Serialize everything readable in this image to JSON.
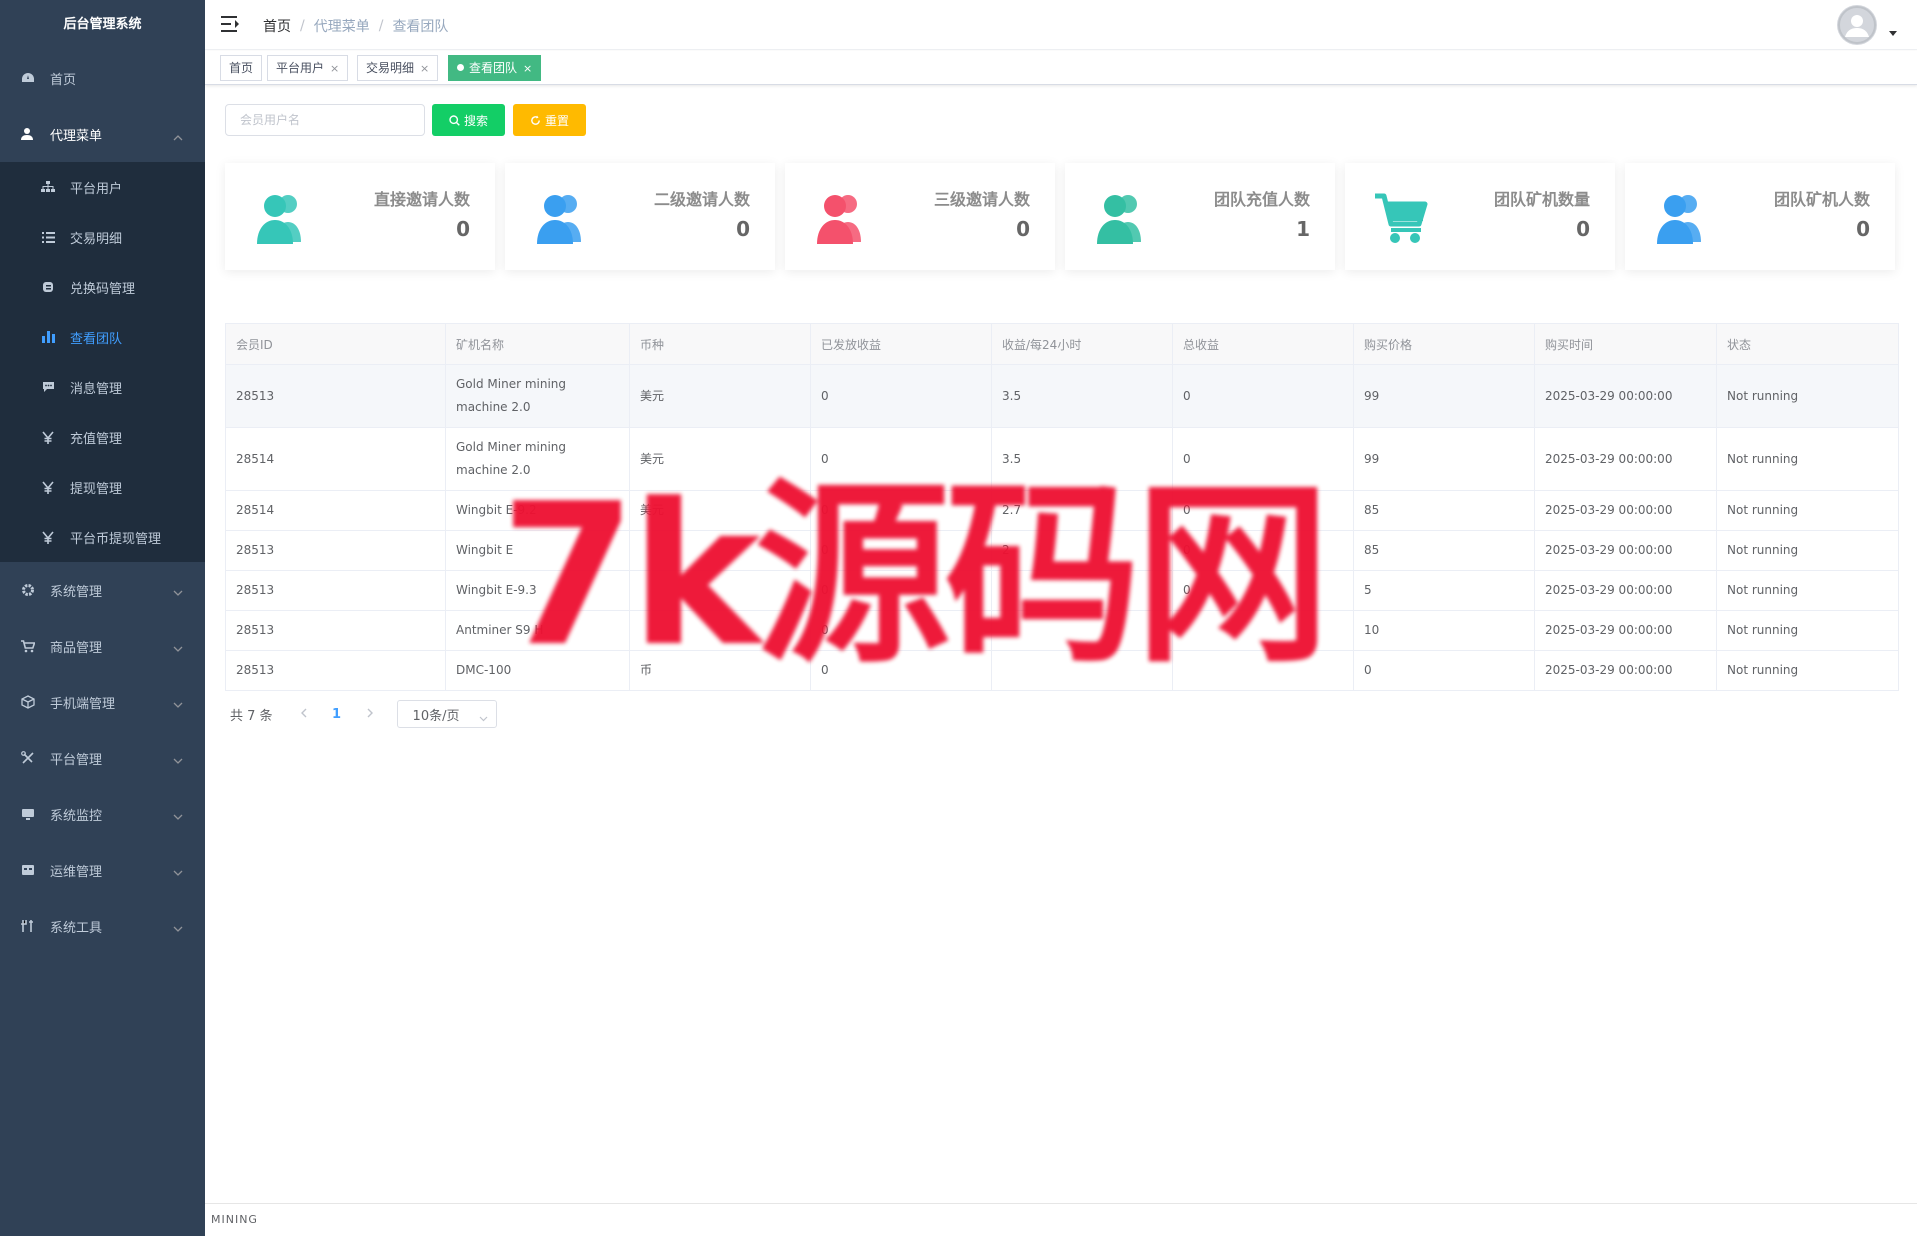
{
  "app": {
    "title": "后台管理系统"
  },
  "sidebar": {
    "items": [
      {
        "label": "首页",
        "icon": "dashboard-icon"
      },
      {
        "label": "代理菜单",
        "icon": "user-icon",
        "expanded": true,
        "children": [
          {
            "label": "平台用户",
            "icon": "org-tree-icon"
          },
          {
            "label": "交易明细",
            "icon": "list-icon"
          },
          {
            "label": "兑换码管理",
            "icon": "code-icon"
          },
          {
            "label": "查看团队",
            "icon": "bar-chart-icon",
            "active": true
          },
          {
            "label": "消息管理",
            "icon": "message-icon"
          },
          {
            "label": "充值管理",
            "icon": "yen-icon"
          },
          {
            "label": "提现管理",
            "icon": "yen-icon"
          },
          {
            "label": "平台币提现管理",
            "icon": "yen-icon"
          }
        ]
      },
      {
        "label": "系统管理",
        "icon": "gear-icon"
      },
      {
        "label": "商品管理",
        "icon": "shopping-cart-icon"
      },
      {
        "label": "手机端管理",
        "icon": "box-icon"
      },
      {
        "label": "平台管理",
        "icon": "tools-icon"
      },
      {
        "label": "系统监控",
        "icon": "monitor-icon"
      },
      {
        "label": "运维管理",
        "icon": "server-icon"
      },
      {
        "label": "系统工具",
        "icon": "wrench-icon"
      }
    ]
  },
  "breadcrumb": {
    "home": "首页",
    "parent": "代理菜单",
    "current": "查看团队",
    "separator": "/"
  },
  "tags": [
    {
      "label": "首页",
      "closable": false,
      "active": false
    },
    {
      "label": "平台用户",
      "closable": true,
      "active": false
    },
    {
      "label": "交易明细",
      "closable": true,
      "active": false
    },
    {
      "label": "查看团队",
      "closable": true,
      "active": true
    }
  ],
  "tag_close_glyph": "×",
  "search": {
    "placeholder": "会员用户名",
    "search_label": "搜索",
    "reset_label": "重置"
  },
  "cards": [
    {
      "title": "直接邀请人数",
      "value": "0",
      "icon": "people-icon",
      "color": "#36c6b8"
    },
    {
      "title": "二级邀请人数",
      "value": "0",
      "icon": "people-icon",
      "color": "#3a9ff0"
    },
    {
      "title": "三级邀请人数",
      "value": "0",
      "icon": "people-icon",
      "color": "#f4516c"
    },
    {
      "title": "团队充值人数",
      "value": "1",
      "icon": "people-icon",
      "color": "#34bfa3"
    },
    {
      "title": "团队矿机数量",
      "value": "0",
      "icon": "shopping-cart-icon",
      "color": "#36c6b8"
    },
    {
      "title": "团队矿机人数",
      "value": "0",
      "icon": "people-icon",
      "color": "#3a9ff0"
    }
  ],
  "table": {
    "columns": [
      "会员ID",
      "矿机名称",
      "币种",
      "已发放收益",
      "收益/每24小时",
      "总收益",
      "购买价格",
      "购买时间",
      "状态"
    ],
    "rows": [
      [
        "28513",
        "Gold Miner mining machine 2.0",
        "美元",
        "0",
        "3.5",
        "0",
        "99",
        "2025-03-29 00:00:00",
        "Not running"
      ],
      [
        "28514",
        "Gold Miner mining machine 2.0",
        "美元",
        "0",
        "3.5",
        "0",
        "99",
        "2025-03-29 00:00:00",
        "Not running"
      ],
      [
        "28514",
        "Wingbit E-9.2",
        "美元",
        "0",
        "2.7",
        "0",
        "85",
        "2025-03-29 00:00:00",
        "Not running"
      ],
      [
        "28513",
        "Wingbit E",
        "",
        "0",
        "2",
        "0",
        "85",
        "2025-03-29 00:00:00",
        "Not running"
      ],
      [
        "28513",
        "Wingbit E-9.3",
        "",
        "0",
        "",
        "0",
        "5",
        "2025-03-29 00:00:00",
        "Not running"
      ],
      [
        "28513",
        "Antminer S9 H",
        "",
        "0",
        "",
        "",
        "10",
        "2025-03-29 00:00:00",
        "Not running"
      ],
      [
        "28513",
        "DMC-100",
        "币",
        "0",
        "",
        "",
        "0",
        "2025-03-29 00:00:00",
        "Not running"
      ]
    ]
  },
  "pagination": {
    "total_text": "共 7 条",
    "current_page": "1",
    "page_size": "10条/页"
  },
  "watermark": "7k源码网",
  "footer": "MINING"
}
